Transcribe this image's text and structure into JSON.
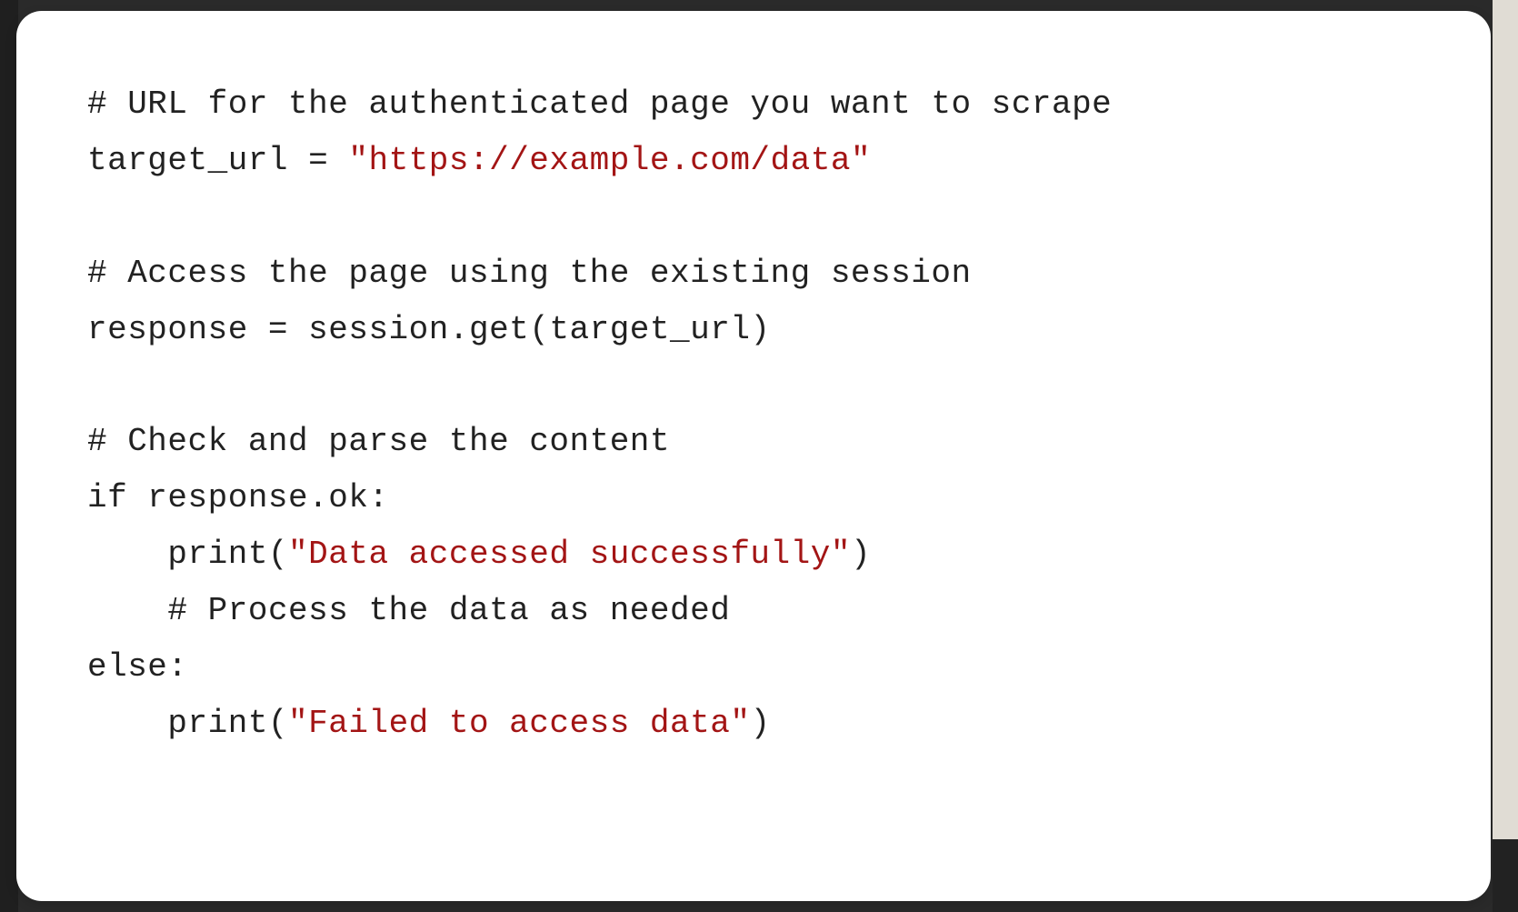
{
  "code": {
    "tokens": [
      {
        "cls": "comment",
        "text": "# URL for the authenticated page you want to scrape"
      },
      {
        "cls": "plain",
        "text": "\n"
      },
      {
        "cls": "plain",
        "text": "target_url = "
      },
      {
        "cls": "string",
        "text": "\"https://example.com/data\""
      },
      {
        "cls": "plain",
        "text": "\n"
      },
      {
        "cls": "plain",
        "text": "\n"
      },
      {
        "cls": "comment",
        "text": "# Access the page using the existing session"
      },
      {
        "cls": "plain",
        "text": "\n"
      },
      {
        "cls": "plain",
        "text": "response = session.get(target_url)"
      },
      {
        "cls": "plain",
        "text": "\n"
      },
      {
        "cls": "plain",
        "text": "\n"
      },
      {
        "cls": "comment",
        "text": "# Check and parse the content"
      },
      {
        "cls": "plain",
        "text": "\n"
      },
      {
        "cls": "plain",
        "text": "if response.ok:"
      },
      {
        "cls": "plain",
        "text": "\n"
      },
      {
        "cls": "plain",
        "text": "    print("
      },
      {
        "cls": "string",
        "text": "\"Data accessed successfully\""
      },
      {
        "cls": "plain",
        "text": ")"
      },
      {
        "cls": "plain",
        "text": "\n"
      },
      {
        "cls": "plain",
        "text": "    "
      },
      {
        "cls": "comment",
        "text": "# Process the data as needed"
      },
      {
        "cls": "plain",
        "text": "\n"
      },
      {
        "cls": "plain",
        "text": "else:"
      },
      {
        "cls": "plain",
        "text": "\n"
      },
      {
        "cls": "plain",
        "text": "    print("
      },
      {
        "cls": "string",
        "text": "\"Failed to access data\""
      },
      {
        "cls": "plain",
        "text": ")"
      }
    ]
  }
}
